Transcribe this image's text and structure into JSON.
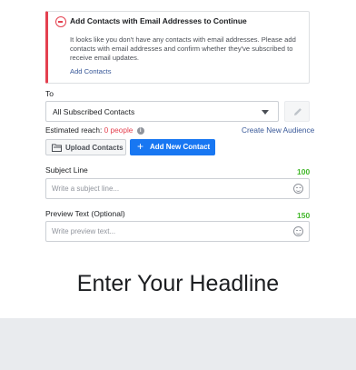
{
  "alert": {
    "title": "Add Contacts with Email Addresses to Continue",
    "body": "It looks like you don't have any contacts with email addresses. Please add contacts with email addresses and confirm whether they've subscribed to receive email updates.",
    "link": "Add Contacts"
  },
  "to": {
    "label": "To",
    "selected": "All Subscribed Contacts"
  },
  "reach": {
    "label": "Estimated reach:",
    "value": "0 people",
    "create_link": "Create New Audience"
  },
  "buttons": {
    "upload": "Upload Contacts",
    "add": "Add New Contact"
  },
  "subject": {
    "label": "Subject Line",
    "count": "100",
    "placeholder": "Write a subject line..."
  },
  "preview": {
    "label": "Preview Text (Optional)",
    "count": "150",
    "placeholder": "Write preview text..."
  },
  "headline": "Enter Your Headline",
  "colors": {
    "accent": "#1877f2",
    "error": "#e4404f",
    "success": "#42b72a",
    "link": "#385898"
  }
}
